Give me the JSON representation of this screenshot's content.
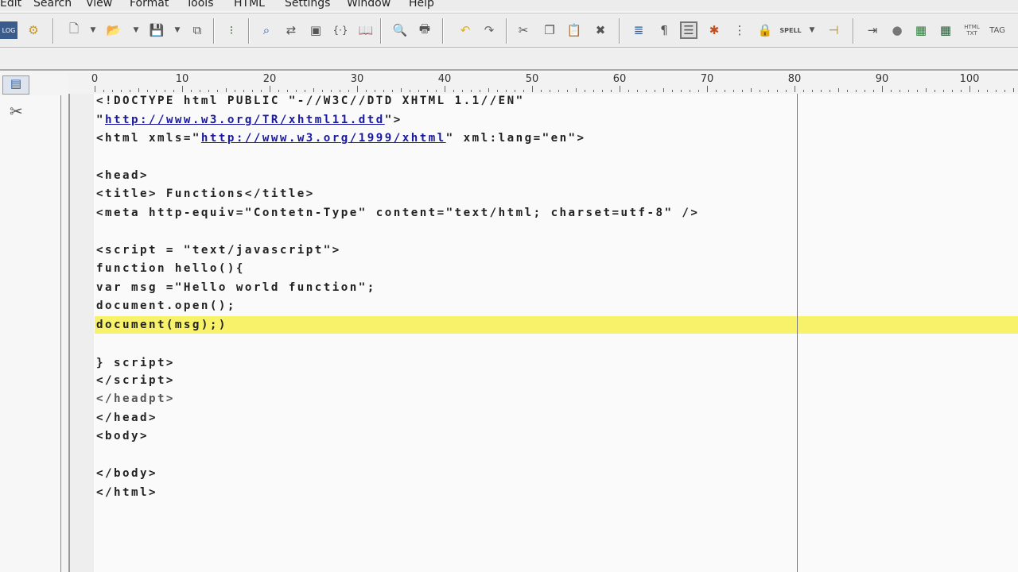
{
  "menu": [
    "Edit",
    "Search",
    "View",
    "Format",
    "Tools",
    "HTML",
    "Settings",
    "Window",
    "Help"
  ],
  "toolbar_icons": [
    "log-icon",
    "settings-icon",
    "new-file-icon",
    "open-folder-icon",
    "save-icon",
    "save-all-icon",
    "tree-icon",
    "find-icon",
    "replace-icon",
    "find-in-files-icon",
    "braces-icon",
    "book-icon",
    "print-preview-icon",
    "print-icon",
    "undo-icon",
    "redo-icon",
    "cut-icon",
    "copy-icon",
    "paste-icon",
    "delete-icon",
    "word-wrap-icon",
    "pilcrow-icon",
    "column-mode-icon",
    "cpp-icon",
    "line-numbers-icon",
    "lock-icon",
    "spell-icon",
    "pin-icon",
    "indent-icon",
    "circle-icon",
    "hex-icon",
    "hex10-icon",
    "html-to-text-icon",
    "tag-icon"
  ],
  "toolbar_text": {
    "spell": "SPELL",
    "html_txt": "HTML TXT",
    "tag": "TAG"
  },
  "ruler": [
    "0",
    "10",
    "20",
    "30",
    "40",
    "50",
    "60",
    "70",
    "80",
    "90",
    "100"
  ],
  "code": {
    "l1": "<!DOCTYPE html PUBLIC \"-//W3C//DTD XHTML 1.1//EN\"",
    "l2a": "\"",
    "l2b": "http://www.w3.org/TR/xhtml11.dtd",
    "l2c": "\">",
    "l3a": "<html xmls=\"",
    "l3b": "http://www.w3.org/1999/xhtml",
    "l3c": "\" xml:lang=\"en\">",
    "l5": "<head>",
    "l6": "<title> Functions</title>",
    "l7": "<meta http-equiv=\"Contetn-Type\" content=\"text/html; charset=utf-8\" />",
    "l9": "<script = \"text/javascript\">",
    "l10": "function hello(){",
    "l11": "var msg =\"Hello world function\";",
    "l12": "document.open();",
    "l13": "document(msg);)",
    "l15": "} script>",
    "l16": "</script>",
    "l17": "</headpt>",
    "l18": "</head>",
    "l19": "<body>",
    "l21": "</body>",
    "l22": "</html>"
  }
}
